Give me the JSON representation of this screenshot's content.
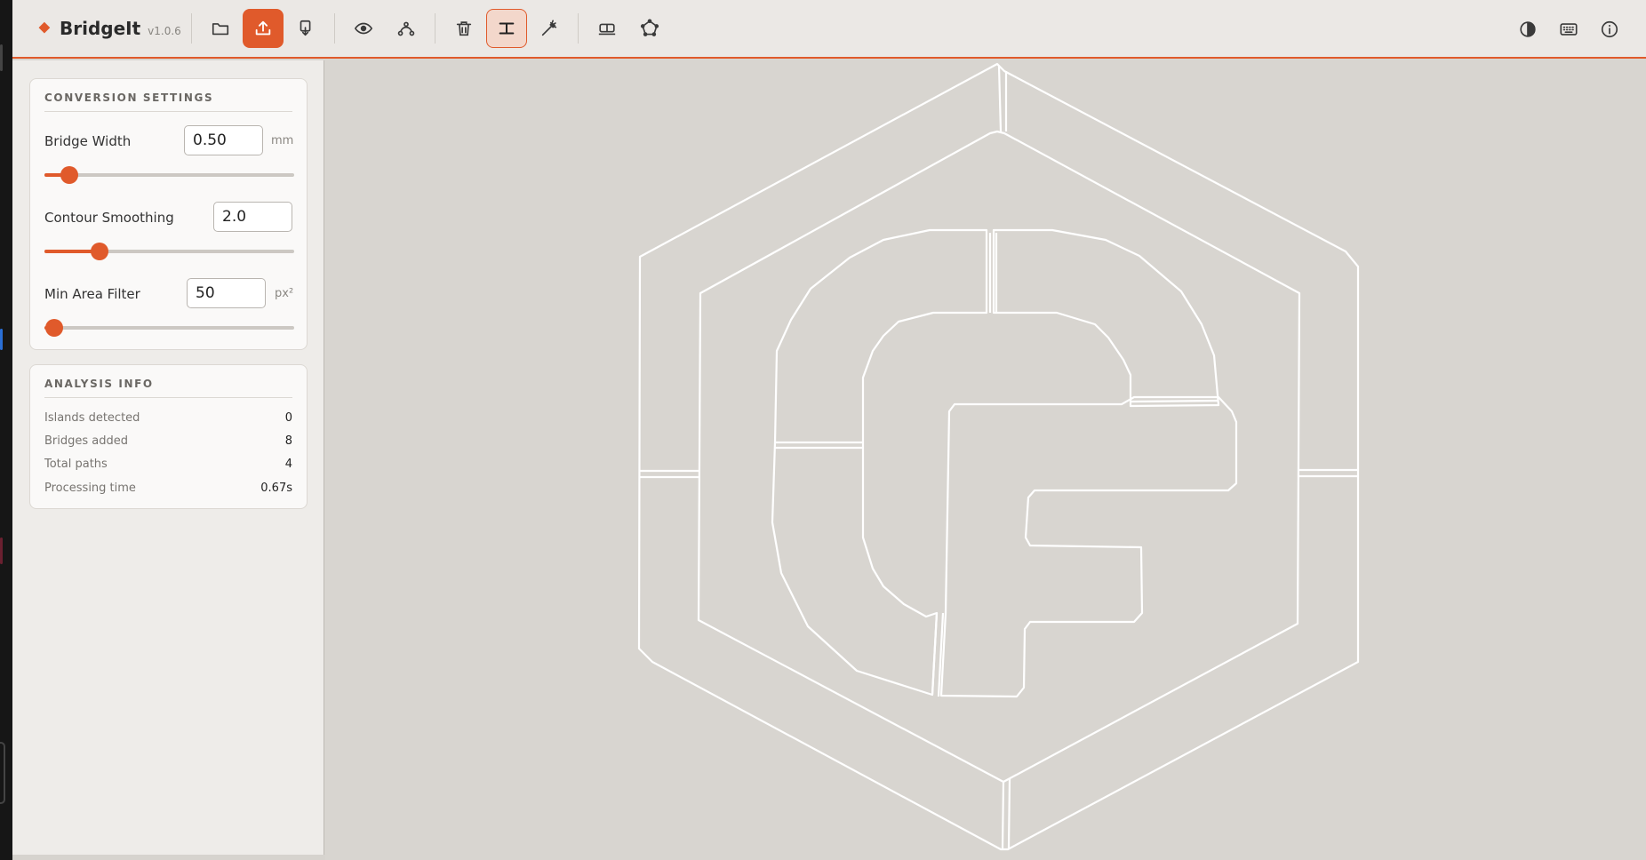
{
  "app": {
    "name": "BridgeIt",
    "version": "v1.0.6"
  },
  "toolbar": {
    "left_groups": [
      [
        "folder-icon",
        "upload-icon",
        "download-icon"
      ],
      [
        "eye-icon",
        "bezier-icon"
      ],
      [
        "trash-icon",
        "bridge-icon",
        "magic-wand-icon"
      ],
      [
        "stencil-icon",
        "polygon-icon"
      ]
    ],
    "active_primary": "upload-icon",
    "active_toggle": "bridge-icon",
    "right_icons": [
      "contrast-icon",
      "keyboard-icon",
      "info-icon"
    ],
    "accent_color": "#e05a2b"
  },
  "conversion": {
    "title": "CONVERSION SETTINGS",
    "bridge_width": {
      "label": "Bridge Width",
      "value": "0.50",
      "unit": "mm",
      "slider_fraction": 0.1
    },
    "contour_smoothing": {
      "label": "Contour Smoothing",
      "value": "2.0",
      "slider_fraction": 0.22
    },
    "min_area": {
      "label": "Min Area Filter",
      "value": "50",
      "unit": "px²",
      "slider_fraction": 0.04
    }
  },
  "analysis": {
    "title": "ANALYSIS INFO",
    "rows": [
      {
        "label": "Islands detected",
        "value": "0"
      },
      {
        "label": "Bridges added",
        "value": "8"
      },
      {
        "label": "Total paths",
        "value": "4"
      },
      {
        "label": "Processing time",
        "value": "0.67s"
      }
    ]
  }
}
